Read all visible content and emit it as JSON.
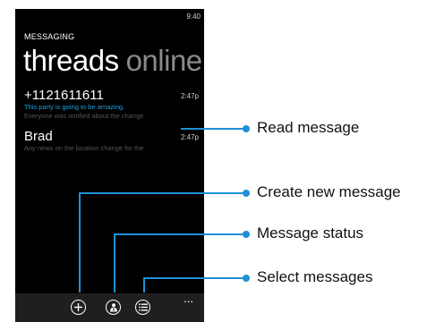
{
  "status_bar": {
    "time": "9:40"
  },
  "header": {
    "app_title": "MESSAGING",
    "pivot_active": "threads",
    "pivot_inactive": "online"
  },
  "threads": [
    {
      "name": "+1121611611",
      "time": "2:47p",
      "preview_line1": "This party is going to be amazing.",
      "preview_line2": "Everyone was notified about the change"
    },
    {
      "name": "Brad",
      "time": "2:47p",
      "preview_line1": "Any news on the location change for the"
    }
  ],
  "appbar": {
    "more_label": "...",
    "buttons": [
      {
        "icon": "plus-icon",
        "callout": "Create new message"
      },
      {
        "icon": "person-status-icon",
        "callout": "Message status"
      },
      {
        "icon": "list-select-icon",
        "callout": "Select messages"
      }
    ]
  },
  "callouts": {
    "read_message": "Read message",
    "create_new_message": "Create new message",
    "message_status": "Message status",
    "select_messages": "Select messages"
  },
  "colors": {
    "accent": "#1ba1e2",
    "callout": "#1e90d6",
    "screen_bg": "#000000",
    "appbar_bg": "#1f1f1f"
  }
}
